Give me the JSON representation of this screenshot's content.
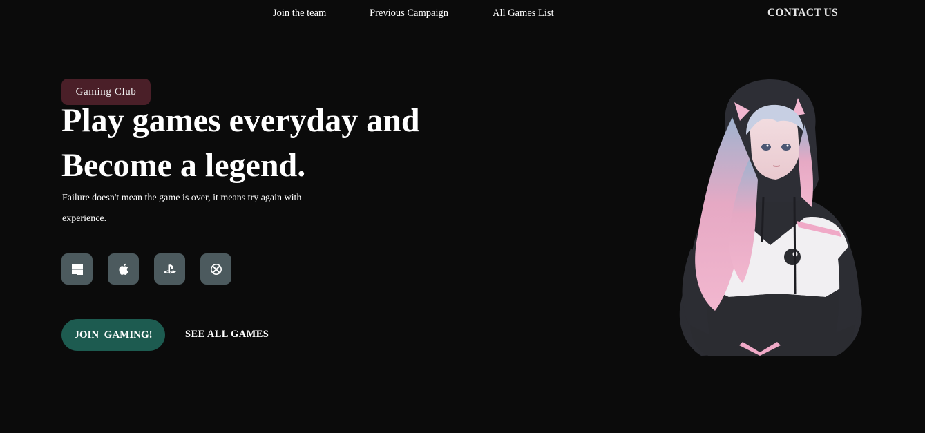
{
  "nav": {
    "links": [
      "Join the team",
      "Previous Campaign",
      "All Games List"
    ],
    "contact": "CONTACT US"
  },
  "hero": {
    "badge": "Gaming Club",
    "headline_line1": "Play games everyday and",
    "headline_line2": "Become a legend.",
    "subtext": "Failure doesn't mean the game is over, it means try again with experience.",
    "platforms": [
      "windows-icon",
      "apple-icon",
      "playstation-icon",
      "xbox-icon"
    ],
    "join_button": "JOIN  GAMING!",
    "see_all_link": "SEE ALL GAMES"
  },
  "colors": {
    "background": "#0b0b0b",
    "badge_bg": "#4a1f28",
    "platform_bg": "#4c5a5e",
    "join_bg": "#1d5b50"
  }
}
